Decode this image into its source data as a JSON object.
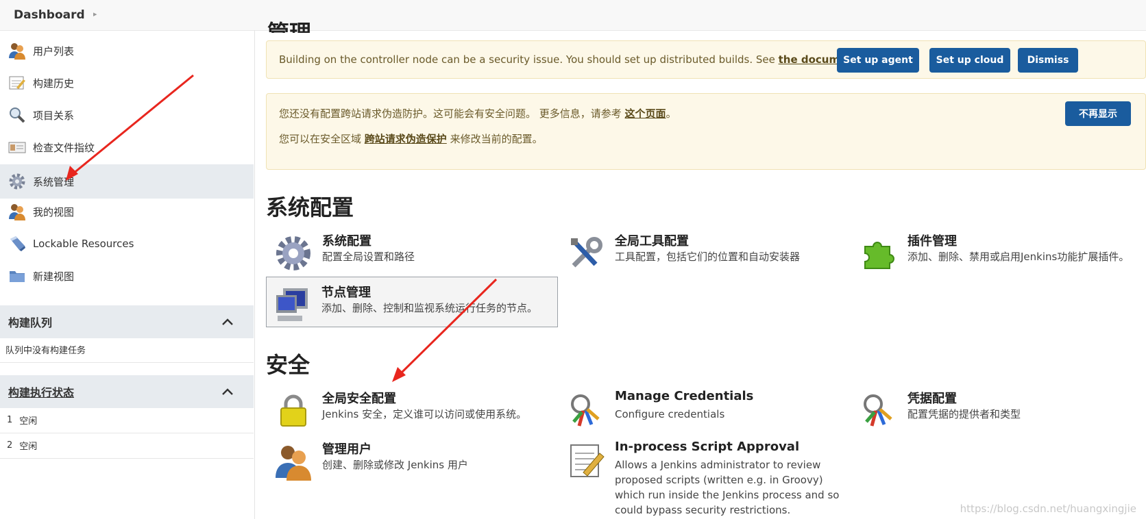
{
  "breadcrumb": {
    "home": "Dashboard"
  },
  "sidebar": {
    "tasks": [
      {
        "label": "用户列表",
        "icon": "users-icon"
      },
      {
        "label": "构建历史",
        "icon": "notepad-icon"
      },
      {
        "label": "项目关系",
        "icon": "magnifier-icon"
      },
      {
        "label": "检查文件指纹",
        "icon": "fingerprint-icon"
      },
      {
        "label": "系统管理",
        "icon": "gear-icon",
        "active": true
      },
      {
        "label": "我的视图",
        "icon": "users-icon"
      },
      {
        "label": "Lockable Resources",
        "icon": "usb-icon"
      },
      {
        "label": "新建视图",
        "icon": "folder-icon"
      }
    ],
    "build_queue": {
      "title": "构建队列",
      "empty_text": "队列中没有构建任务"
    },
    "executors": {
      "title": "构建执行状态",
      "rows": [
        {
          "num": "1",
          "status": "空闲"
        },
        {
          "num": "2",
          "status": "空闲"
        }
      ]
    }
  },
  "main": {
    "cut_title": "管理",
    "alert1": {
      "text": "Building on the controller node can be a security issue. You should set up distributed builds. See ",
      "link": "the documentation",
      "after": ".",
      "buttons": [
        "Set up agent",
        "Set up cloud",
        "Dismiss"
      ]
    },
    "alert2": {
      "line1_text": "您还没有配置跨站请求伪造防护。这可能会有安全问题。 更多信息，请参考 ",
      "line1_link": "这个页面",
      "line1_after": "。",
      "line2_text": "您可以在安全区域 ",
      "line2_link": "跨站请求伪造保护",
      "line2_after": " 来修改当前的配置。",
      "button": "不再显示"
    },
    "sections": [
      {
        "title": "系统配置",
        "items": [
          {
            "title": "系统配置",
            "desc": "配置全局设置和路径",
            "icon": "gear-icon"
          },
          {
            "title": "全局工具配置",
            "desc": "工具配置，包括它们的位置和自动安装器",
            "icon": "tools-icon"
          },
          {
            "title": "插件管理",
            "desc": "添加、删除、禁用或启用Jenkins功能扩展插件。",
            "icon": "puzzle-icon"
          },
          {
            "title": "节点管理",
            "desc": "添加、删除、控制和监视系统运行任务的节点。",
            "icon": "computer-icon"
          }
        ]
      },
      {
        "title": "安全",
        "items": [
          {
            "title": "全局安全配置",
            "desc": "Jenkins 安全，定义谁可以访问或使用系统。",
            "icon": "lock-icon"
          },
          {
            "title": "Manage Credentials",
            "desc": "Configure credentials",
            "icon": "keys-icon"
          },
          {
            "title": "凭据配置",
            "desc": "配置凭据的提供者和类型",
            "icon": "keys-icon"
          },
          {
            "title": "管理用户",
            "desc": "创建、删除或修改 Jenkins 用户",
            "icon": "users-icon"
          },
          {
            "title": "In-process Script Approval",
            "desc": "Allows a Jenkins administrator to review proposed scripts (written e.g. in Groovy) which run inside the Jenkins process and so could bypass security restrictions.",
            "icon": "notepad-icon"
          }
        ]
      }
    ]
  },
  "watermark": "https://blog.csdn.net/huangxingjie",
  "colors": {
    "accent": "#1a5c9e",
    "alert_bg": "#fdf8e8",
    "arrow": "#e8261e"
  }
}
